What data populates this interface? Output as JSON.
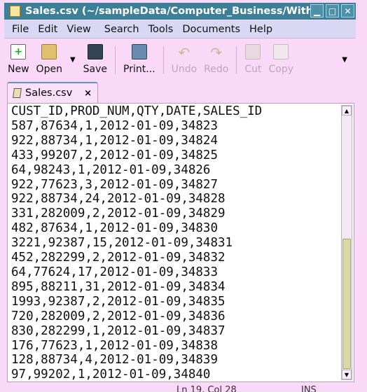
{
  "window": {
    "title": "Sales.csv (~/sampleData/Computer_Business/With"
  },
  "menu": [
    "File",
    "Edit",
    "View",
    "Search",
    "Tools",
    "Documents",
    "Help"
  ],
  "toolbar": [
    {
      "label": "New",
      "icon": "new-document-icon",
      "enabled": true
    },
    {
      "label": "Open",
      "icon": "folder-open-icon",
      "enabled": true
    },
    {
      "label": "Save",
      "icon": "floppy-save-icon",
      "enabled": true
    },
    {
      "label": "Print...",
      "icon": "printer-icon",
      "enabled": true
    },
    {
      "label": "Undo",
      "icon": "undo-icon",
      "enabled": false
    },
    {
      "label": "Redo",
      "icon": "redo-icon",
      "enabled": false
    },
    {
      "label": "Cut",
      "icon": "scissors-icon",
      "enabled": false
    },
    {
      "label": "Copy",
      "icon": "copy-icon",
      "enabled": false
    }
  ],
  "tab": {
    "label": "Sales.csv",
    "close": "×"
  },
  "lines": [
    "CUST_ID,PROD_NUM,QTY,DATE,SALES_ID",
    "587,87634,1,2012-01-09,34823",
    "922,88734,1,2012-01-09,34824",
    "433,99207,2,2012-01-09,34825",
    "64,98243,1,2012-01-09,34826",
    "922,77623,3,2012-01-09,34827",
    "922,88734,24,2012-01-09,34828",
    "331,282009,2,2012-01-09,34829",
    "482,87634,1,2012-01-09,34830",
    "3221,92387,15,2012-01-09,34831",
    "452,282299,2,2012-01-09,34832",
    "64,77624,17,2012-01-09,34833",
    "895,88211,31,2012-01-09,34834",
    "1993,92387,2,2012-01-09,34835",
    "720,282009,2,2012-01-09,34836",
    "830,282299,1,2012-01-09,34837",
    "176,77623,1,2012-01-09,34838",
    "128,88734,4,2012-01-09,34839",
    "97,99202,1,2012-01-09,34840"
  ],
  "status": {
    "position": "Ln 19, Col 28",
    "mode": "INS"
  },
  "colors": {
    "titlebar": "#3d7f96",
    "menubar": "#d8d8f4",
    "toolbar": "#fad8f8",
    "scroll_thumb": "#d8d8a8"
  }
}
